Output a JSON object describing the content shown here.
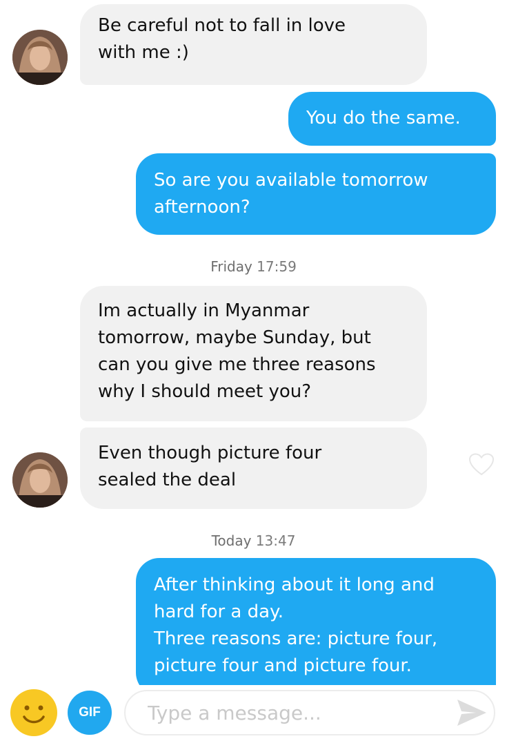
{
  "messages": [
    {
      "direction": "in",
      "text": "Be careful not to fall in love\nwith me :)"
    },
    {
      "direction": "out",
      "text": "You do the same."
    },
    {
      "direction": "out",
      "text": "So are you available tomorrow\nafternoon?"
    },
    {
      "direction": "in",
      "text": "Im actually in Myanmar\ntomorrow, maybe Sunday, but\ncan you give me three reasons\nwhy I should meet you?"
    },
    {
      "direction": "in",
      "text": "Even though picture four\nsealed the deal"
    },
    {
      "direction": "out",
      "text": "After thinking about it long and\nhard for a day.\nThree reasons are: picture four,\npicture four and picture four."
    }
  ],
  "timestamps": [
    {
      "day": "Friday",
      "time": "17:59"
    },
    {
      "day": "Today",
      "time": "13:47"
    }
  ],
  "composer": {
    "gif_label": "GIF",
    "placeholder": "Type a message..."
  },
  "icons": {
    "emoji": "smiley-face-icon",
    "send": "send-arrow-icon",
    "like": "heart-outline-icon",
    "avatar": "contact-avatar"
  },
  "colors": {
    "outgoing_bubble": "#1fa9f2",
    "incoming_bubble": "#f1f1f1",
    "gif_button": "#21a8ef",
    "emoji_button": "#f8c824"
  }
}
